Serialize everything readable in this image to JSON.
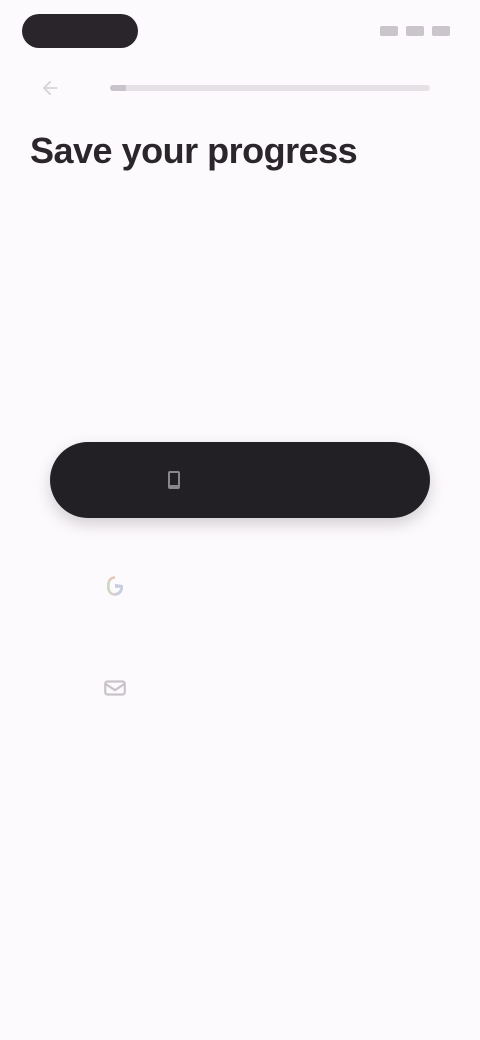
{
  "status_bar": {
    "pill_color": "#2a252b",
    "right_icons": [
      "signal-icon",
      "wifi-icon",
      "battery-icon"
    ]
  },
  "header": {
    "back_icon": "arrow-back-icon",
    "progress": 0.05
  },
  "page": {
    "title": "Save your progress",
    "subtitle": ""
  },
  "actions": {
    "primary_label": "",
    "primary_icon": "device-icon",
    "options": [
      {
        "label": "",
        "icon": "email-icon"
      },
      {
        "label": "",
        "icon": "link-icon"
      }
    ]
  },
  "colors": {
    "background": "#fdfafd",
    "primary_button": "#232025",
    "title": "#2a262b"
  }
}
